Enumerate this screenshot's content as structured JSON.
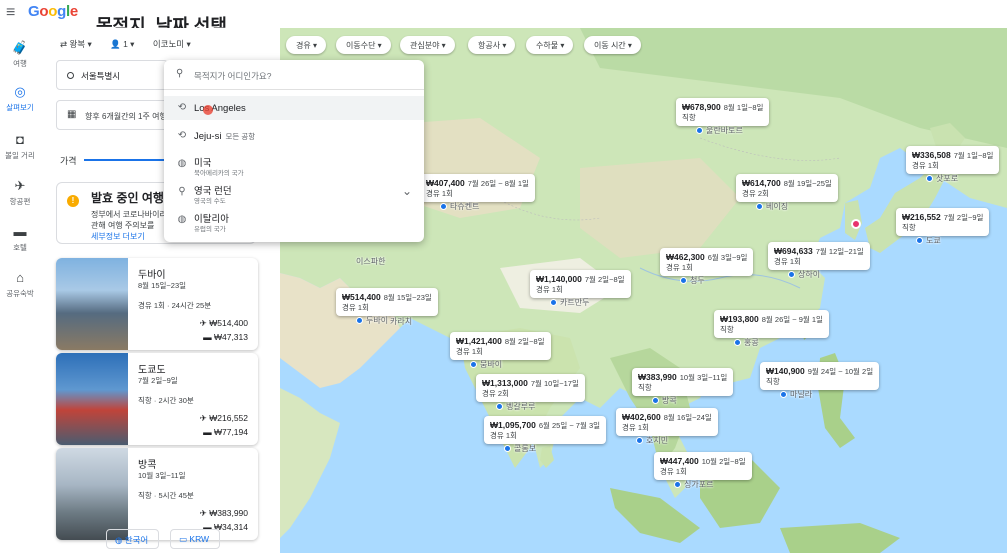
{
  "app": {
    "logo": "Google",
    "logo_colors": [
      "#4285F4",
      "#EA4335",
      "#FBBC05",
      "#4285F4",
      "#34A853",
      "#EA4335"
    ],
    "page_heading": "목적지, 날짜 선택"
  },
  "rail": {
    "items": [
      {
        "icon": "luggage-icon",
        "glyph": "🧳",
        "label": "여행",
        "active": false
      },
      {
        "icon": "explore-icon",
        "glyph": "◎",
        "label": "살펴보기",
        "active": true
      },
      {
        "icon": "camera-icon",
        "glyph": "◘",
        "label": "볼일 거리",
        "active": false
      },
      {
        "icon": "flight-icon",
        "glyph": "✈",
        "label": "항공편",
        "active": false
      },
      {
        "icon": "hotel-icon",
        "glyph": "▬",
        "label": "호텔",
        "active": false
      },
      {
        "icon": "home-icon",
        "glyph": "⌂",
        "label": "공유숙박",
        "active": false
      }
    ]
  },
  "search": {
    "trip_type": "⇄ 왕복 ▾",
    "passengers": "👤 1 ▾",
    "cabin": "이코노미 ▾",
    "origin": "서울특별시",
    "date": "향후 6개월간의 1주 여행",
    "price_tab": "가격"
  },
  "alert": {
    "title": "발효 중인 여행",
    "body_line1": "정부에서 코로나바이러스",
    "body_line2": "관해 여행 주의보를",
    "link": "세부정보 더보기"
  },
  "destinations": [
    {
      "name": "두바이",
      "dates": "8월 15일~23일",
      "route": "경유 1회 · 24시간 25분",
      "flight_price": "₩514,400",
      "hotel_price": "₩47,313"
    },
    {
      "name": "도쿄도",
      "dates": "7월 2일~9일",
      "route": "직항 · 2시간 30분",
      "flight_price": "₩216,552",
      "hotel_price": "₩77,194"
    },
    {
      "name": "방콕",
      "dates": "10월 3일~11일",
      "route": "직항 · 5시간 45분",
      "flight_price": "₩383,990",
      "hotel_price": "₩34,314"
    }
  ],
  "footer": {
    "language": "한국어",
    "currency": "KRW"
  },
  "filters": [
    "경유",
    "이동수단",
    "관심분야",
    "항공사",
    "수하물",
    "이동 시간"
  ],
  "dropdown": {
    "placeholder": "목적지가 어디인가요?",
    "items": [
      {
        "icon": "history-icon",
        "glyph": "⟲",
        "title": "Los Angeles",
        "sub": "",
        "desc": ""
      },
      {
        "icon": "history-icon",
        "glyph": "⟲",
        "title": "Jeju-si",
        "sub": "모든 공항",
        "desc": ""
      },
      {
        "icon": "globe-icon",
        "glyph": "◍",
        "title": "미국",
        "sub": "",
        "desc": "북아메리카의 국가"
      },
      {
        "icon": "pin-icon",
        "glyph": "⚲",
        "title": "영국 런던",
        "sub": "",
        "desc": "영국의 수도"
      },
      {
        "icon": "globe-icon",
        "glyph": "◍",
        "title": "이탈리아",
        "sub": "",
        "desc": "유럽의 국가"
      }
    ]
  },
  "map": {
    "pins": [
      {
        "price": "₩678,900",
        "dates": "8월 1일~8일",
        "stops": "직항",
        "city": "울란바토르"
      },
      {
        "price": "₩336,508",
        "dates": "7월 1일~8일",
        "stops": "경유 1회",
        "city": "삿포로"
      },
      {
        "price": "₩614,700",
        "dates": "8월 19일~25일",
        "stops": "경유 2회",
        "city": "베이징"
      },
      {
        "price": "₩216,552",
        "dates": "7월 2일~9일",
        "stops": "직항",
        "city": "도쿄"
      },
      {
        "price": "₩462,300",
        "dates": "6월 3일~9일",
        "stops": "경유 1회",
        "city": "청두"
      },
      {
        "price": "₩694,633",
        "dates": "7월 12일~21일",
        "stops": "경유 1회",
        "city": "상하이"
      },
      {
        "price": "₩1,140,000",
        "dates": "7월 2일~8일",
        "stops": "경유 1회",
        "city": "카트만두"
      },
      {
        "price": "₩514,400",
        "dates": "8월 15일~23일",
        "stops": "경유 1회",
        "city": "두바이"
      },
      {
        "price": "₩193,800",
        "dates": "8월 26일 ~ 9월 1일",
        "stops": "직항",
        "city": "홍콩"
      },
      {
        "price": "₩1,421,400",
        "dates": "8월 2일~8일",
        "stops": "경유 1회",
        "city": "뭄바이"
      },
      {
        "price": "₩140,900",
        "dates": "9월 24일 ~ 10월 2일",
        "stops": "직항",
        "city": "마닐라"
      },
      {
        "price": "₩383,990",
        "dates": "10월 3일~11일",
        "stops": "직항",
        "city": "방콕"
      },
      {
        "price": "₩1,313,000",
        "dates": "7월 10일~17일",
        "stops": "경유 2회",
        "city": "벵갈루루"
      },
      {
        "price": "₩402,600",
        "dates": "8월 16일~24일",
        "stops": "경유 1회",
        "city": "호치민"
      },
      {
        "price": "₩1,095,700",
        "dates": "6월 25일 ~ 7월 3일",
        "stops": "경유 1회",
        "city": "콜롬보"
      },
      {
        "price": "₩447,400",
        "dates": "10월 2일~8일",
        "stops": "경유 1회",
        "city": "싱가포르"
      },
      {
        "price": "₩407,400",
        "dates": "7월 26일 ~ 8월 1일",
        "stops": "경유 1회",
        "city": "타슈켄트"
      }
    ],
    "labels": [
      "이스파한",
      "카라치"
    ]
  }
}
